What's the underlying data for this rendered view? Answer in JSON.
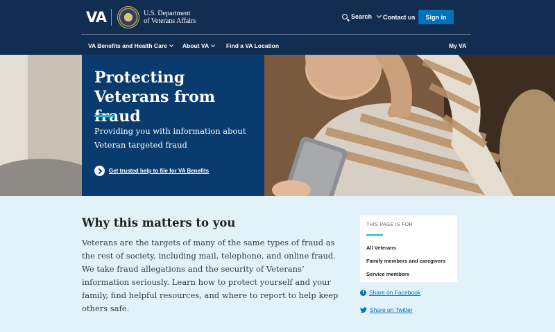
{
  "header": {
    "logo_text": "VA",
    "dept_line1": "U.S. Department",
    "dept_line2": "of Veterans Affairs",
    "search_label": "Search",
    "contact_label": "Contact us",
    "signin_label": "Sign in",
    "nav": {
      "benefits": "VA Benefits and Health Care",
      "about": "About VA",
      "find": "Find a VA Location",
      "myva": "My VA"
    },
    "colors": {
      "background": "#112e51",
      "signin": "#0071bb"
    }
  },
  "hero": {
    "title": "Protecting Veterans from fraud",
    "subtitle": "Providing you with information about Veteran targeted fraud",
    "cta_label": "Get trusted help to file for VA Benefits",
    "colors": {
      "panel": "#0a3b6e",
      "accent": "#02bfe7"
    }
  },
  "main": {
    "heading": "Why this matters to you",
    "body": "Veterans are the targets of many of the same types of fraud as the rest of society, including mail, telephone, and online fraud. We take fraud allegations and the security of Veterans’ information seriously. Learn how to protect yourself and your family, find helpful resources, and where to report to help keep others safe."
  },
  "sidebar": {
    "label": "THIS PAGE IS FOR",
    "items": [
      "All Veterans",
      "Family members and caregivers",
      "Service members"
    ]
  },
  "share": {
    "facebook": "Share on Facebook",
    "twitter": "Share on Twitter"
  },
  "icons": [
    "search-icon",
    "chevron-down-icon",
    "va-seal-icon",
    "arrow-right-circle-icon",
    "facebook-icon",
    "twitter-icon"
  ]
}
